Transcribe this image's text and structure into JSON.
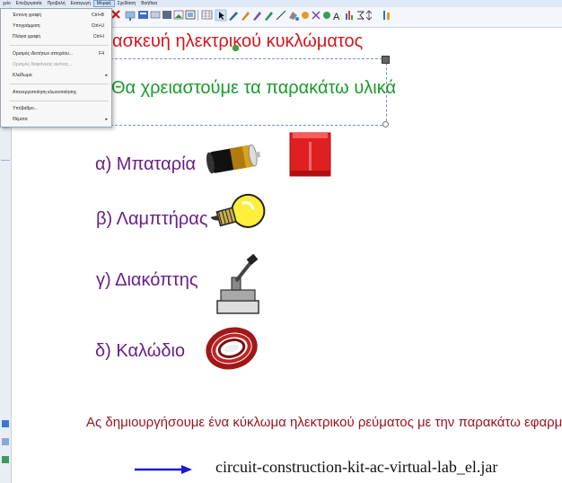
{
  "menubar": {
    "items": [
      "Αρχείο",
      "Επεξεργασία",
      "Προβολή",
      "Εισαγωγή",
      "Μορφή",
      "Σχεδίαση",
      "Βοήθεια"
    ],
    "active_label": "Μορφή"
  },
  "format_menu": {
    "items": [
      {
        "label": "Έντονη γραφή",
        "shortcut": "Ctrl+B"
      },
      {
        "label": "Υπογράμμιση",
        "shortcut": "Ctrl+U"
      },
      {
        "label": "Πλάγια γραφή",
        "shortcut": "Ctrl+I"
      },
      {
        "label": "Ορισμός ιδιοτήτων στοιχείου...",
        "shortcut": "F4"
      },
      {
        "label": "Ορισμός διαφάνειας εικόνας...",
        "shortcut": ""
      },
      {
        "label": "Κλείδωμα",
        "shortcut": ""
      },
      {
        "label": "Απενεργοποίηση κλωνοποίησης",
        "shortcut": ""
      },
      {
        "label": "Υπόβαθρο...",
        "shortcut": ""
      },
      {
        "label": "Θέματα",
        "shortcut": ""
      }
    ]
  },
  "slide": {
    "title": "ασκευή ηλεκτρικού κυκλώματος",
    "subtitle": "Θα χρειαστούμε τα παρακάτω υλικά",
    "items": [
      "α) Μπαταρία",
      "β) Λαμπτήρας",
      "γ) Διακόπτης",
      "δ) Καλώδιο"
    ],
    "bottom_text": "Ας δημιουργήσουμε ένα κύκλωμα ηλεκτρικού ρεύματος με την παρακάτω εφαρμογή.",
    "link": "circuit-construction-kit-ac-virtual-lab_el.jar"
  },
  "left_strip": {
    "top_label": "χείο"
  },
  "colors": {
    "title": "#d0181e",
    "subtitle": "#1a9a2a",
    "items": "#6a1f86",
    "bottom_text": "#9a1420",
    "arrow": "#1a1ad0"
  }
}
